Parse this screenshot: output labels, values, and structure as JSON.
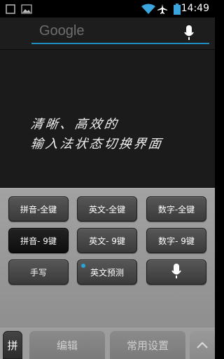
{
  "status_bar": {
    "time": "14:49",
    "icons": [
      "square-icon",
      "image-icon",
      "wifi-icon",
      "airplane-icon",
      "battery-icon"
    ]
  },
  "search": {
    "placeholder": "Google",
    "accent_color": "#1d8fc3"
  },
  "content": {
    "line1": "清晰、高效的",
    "line2": "输入法状态切换界面"
  },
  "keyboard": {
    "keys": [
      {
        "label": "拼音-全键",
        "selected": false
      },
      {
        "label": "英文-全键",
        "selected": false
      },
      {
        "label": "数字-全键",
        "selected": false
      },
      {
        "label": "拼音- 9键",
        "selected": true
      },
      {
        "label": "英文- 9键",
        "selected": false
      },
      {
        "label": "数字- 9键",
        "selected": false
      },
      {
        "label": "手写",
        "selected": false
      },
      {
        "label": "英文预测",
        "selected": false,
        "indicator_color": "#2aa3d8"
      },
      {
        "label": "",
        "icon": "microphone-icon"
      }
    ]
  },
  "tabbar": {
    "logo": "拼",
    "edit": "编辑",
    "settings": "常用设置",
    "up_icon": "chevron-up-icon"
  }
}
